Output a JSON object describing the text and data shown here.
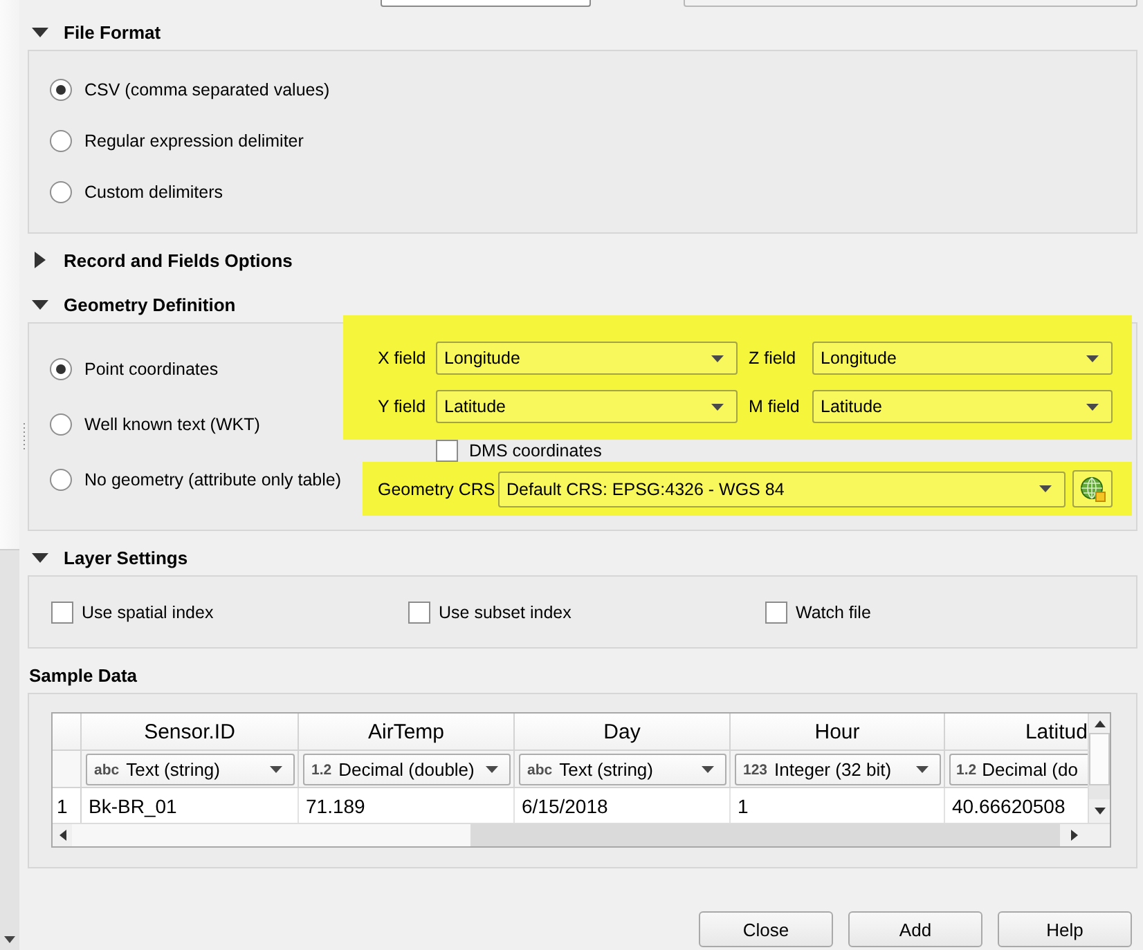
{
  "file_format": {
    "title": "File Format",
    "expanded": true,
    "options": [
      {
        "label": "CSV (comma separated values)",
        "selected": true
      },
      {
        "label": "Regular expression delimiter",
        "selected": false
      },
      {
        "label": "Custom delimiters",
        "selected": false
      }
    ]
  },
  "record_options": {
    "title": "Record and Fields Options",
    "expanded": false
  },
  "geometry_definition": {
    "title": "Geometry Definition",
    "expanded": true,
    "types": [
      {
        "label": "Point coordinates",
        "selected": true
      },
      {
        "label": "Well known text (WKT)",
        "selected": false
      },
      {
        "label": "No geometry (attribute only table)",
        "selected": false
      }
    ],
    "fields": {
      "highlighted": true,
      "items": [
        {
          "label": "X field",
          "value": "Longitude"
        },
        {
          "label": "Z field",
          "value": "Longitude"
        },
        {
          "label": "Y field",
          "value": "Latitude"
        },
        {
          "label": "M field",
          "value": "Latitude"
        }
      ]
    },
    "dms": {
      "label": "DMS coordinates",
      "checked": false
    },
    "crs": {
      "highlighted": true,
      "label": "Geometry CRS",
      "value": "Default CRS: EPSG:4326 - WGS 84"
    }
  },
  "layer_settings": {
    "title": "Layer Settings",
    "expanded": true,
    "options": [
      {
        "label": "Use spatial index",
        "checked": false
      },
      {
        "label": "Use subset index",
        "checked": false
      },
      {
        "label": "Watch file",
        "checked": false
      }
    ]
  },
  "sample_data": {
    "title": "Sample Data",
    "columns": [
      {
        "header": "Sensor.ID",
        "type_icon": "abc",
        "type": "Text (string)"
      },
      {
        "header": "AirTemp",
        "type_icon": "1.2",
        "type": "Decimal (double)"
      },
      {
        "header": "Day",
        "type_icon": "abc",
        "type": "Text (string)"
      },
      {
        "header": "Hour",
        "type_icon": "123",
        "type": "Integer (32 bit)"
      },
      {
        "header": "Latitud",
        "type_icon": "1.2",
        "type": "Decimal (do"
      }
    ],
    "rows": [
      {
        "number": "1",
        "cells": [
          "Bk-BR_01",
          "71.189",
          "6/15/2018",
          "1",
          "40.66620508"
        ]
      }
    ]
  },
  "buttons": [
    {
      "label": "Close"
    },
    {
      "label": "Add"
    },
    {
      "label": "Help"
    }
  ]
}
